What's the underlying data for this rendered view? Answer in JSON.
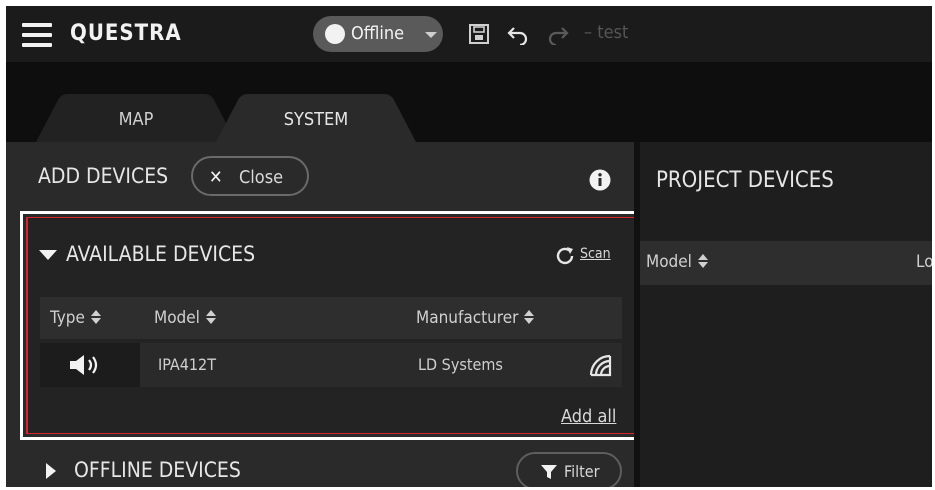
{
  "app": {
    "title": "QUESTRA"
  },
  "toolbar": {
    "status": "Offline",
    "project_name": "– test",
    "icons": [
      "menu-icon",
      "save-icon",
      "undo-icon",
      "redo-icon"
    ]
  },
  "tabs": [
    {
      "label": "MAP",
      "active": false
    },
    {
      "label": "SYSTEM",
      "active": true
    }
  ],
  "add_devices": {
    "title": "ADD DEVICES",
    "close_label": "Close",
    "available": {
      "title": "AVAILABLE DEVICES",
      "scan_label": "Scan",
      "columns": [
        "Type",
        "Model",
        "Manufacturer"
      ],
      "rows": [
        {
          "type_icon": "speaker-icon",
          "model": "IPA412T",
          "manufacturer": "LD Systems",
          "status_icon": "network-icon"
        }
      ],
      "add_all_label": "Add all"
    },
    "offline": {
      "title": "OFFLINE DEVICES",
      "filter_label": "Filter"
    }
  },
  "project_devices": {
    "title": "PROJECT DEVICES",
    "columns": [
      "Model",
      "Lo"
    ]
  },
  "colors": {
    "highlight": "#d8232a",
    "background": "#161616",
    "panel": "#2a2a2a"
  }
}
